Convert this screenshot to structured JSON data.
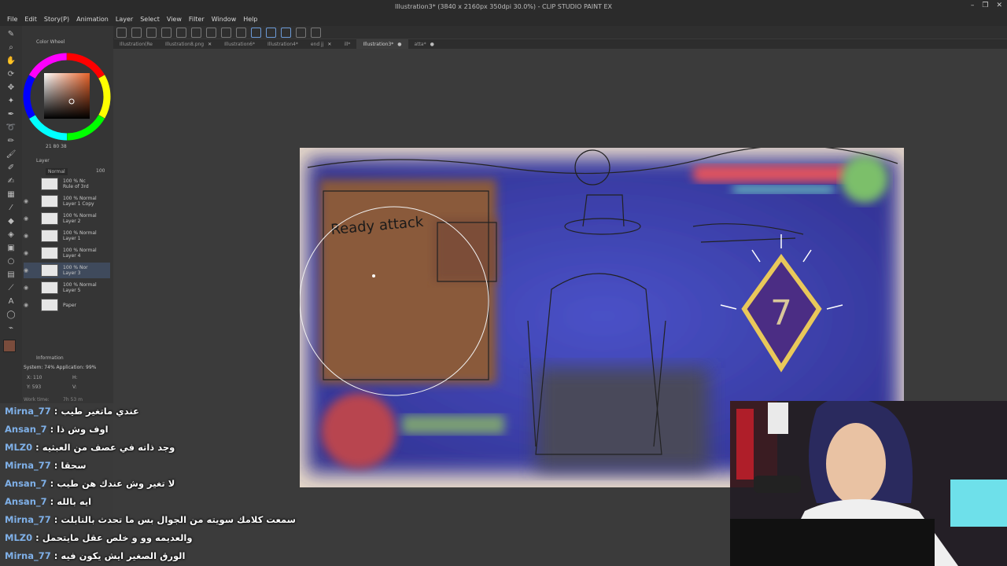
{
  "window": {
    "title": "Illustration3* (3840 x 2160px 350dpi 30.0%) - CLIP STUDIO PAINT EX"
  },
  "menu": [
    "File",
    "Edit",
    "Story(P)",
    "Animation",
    "Layer",
    "Select",
    "View",
    "Filter",
    "Window",
    "Help"
  ],
  "tabs": [
    {
      "label": "Illustration(Re",
      "active": false
    },
    {
      "label": "Illustration8.png",
      "active": false
    },
    {
      "label": "Illustration6*",
      "active": false
    },
    {
      "label": "Illustration4*",
      "active": false
    },
    {
      "label": "end jj",
      "active": false
    },
    {
      "label": "ill*",
      "active": false
    },
    {
      "label": "Illustration3*",
      "active": true
    },
    {
      "label": "atta*",
      "active": false
    }
  ],
  "palette": {
    "color_wheel_title": "Color Wheel",
    "color_values": "21  80  38",
    "layer_panel_title": "Layer",
    "blend_mode": "Normal",
    "opacity": "100",
    "info_title": "Information",
    "system_usage": "System: 74%  Application: 99%",
    "coord_x": "X: 110",
    "coord_y": "Y: 593",
    "coord_h": "H:",
    "coord_v": "V:",
    "work_time": "Work time:",
    "work_time_value": "7h 53 m"
  },
  "layers": [
    {
      "label": "100 % Nc\nRule of 3rd",
      "visible": false
    },
    {
      "label": "100 % Normal\nLayer 1 Copy",
      "visible": true
    },
    {
      "label": "100 % Normal\nLayer 2",
      "visible": true
    },
    {
      "label": "100 % Normal\nLayer 1",
      "visible": true
    },
    {
      "label": "100 % Normal\nLayer 4",
      "visible": true
    },
    {
      "label": "100 % Nor\nLayer 3",
      "visible": true,
      "selected": true
    },
    {
      "label": "100 % Normal\nLayer 5",
      "visible": true
    },
    {
      "label": "Paper",
      "visible": true
    }
  ],
  "canvas": {
    "sketch_text": "Ready attack"
  },
  "chat": [
    {
      "user": "Mirna_77",
      "message": "عندي ماتغير طيب"
    },
    {
      "user": "Ansan_7",
      "message": "اوف وش ذا"
    },
    {
      "user": "MLZ0",
      "message": "وجد ذاته في عصف من العبثيه"
    },
    {
      "user": "Mirna_77",
      "message": "سحقا"
    },
    {
      "user": "Ansan_7",
      "message": "لا تغير وش عندك هن طيب"
    },
    {
      "user": "Ansan_7",
      "message": "ايه بالله"
    },
    {
      "user": "Mirna_77",
      "message": "سمعت كلامك سويته من الجوال بس ما تحدث بالتابلت"
    },
    {
      "user": "MLZ0",
      "message": "والعديمه وو و خلص عقل مايتحمل"
    },
    {
      "user": "Mirna_77",
      "message": "الورق الصغير ايش يكون فيه"
    }
  ],
  "colors": {
    "accent": "#6d9bd8",
    "chat_name": "#7fb0e8",
    "canvas_blue": "#3c3fa8",
    "canvas_brown": "#8a5a3a",
    "health_red": "#e0535f"
  }
}
